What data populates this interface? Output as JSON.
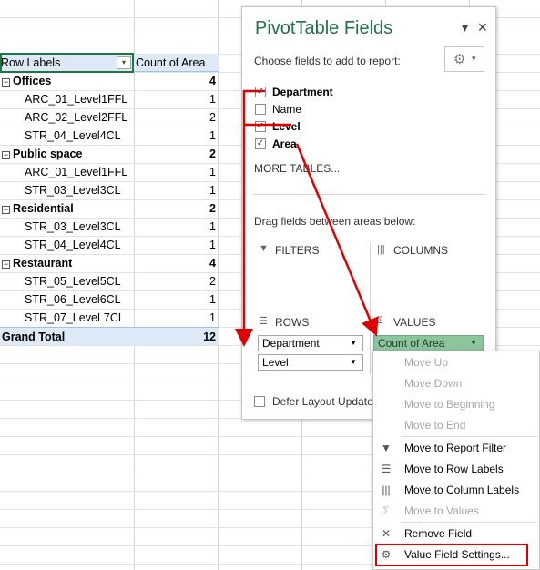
{
  "pivot": {
    "header": {
      "row_labels": "Row Labels",
      "count_col": "Count of Area",
      "filter_glyph": "▾"
    },
    "groups": [
      {
        "name": "Offices",
        "count": "4",
        "items": [
          {
            "name": "ARC_01_Level1FFL",
            "count": "1"
          },
          {
            "name": "ARC_02_Level2FFL",
            "count": "2"
          },
          {
            "name": "STR_04_Level4CL",
            "count": "1"
          }
        ]
      },
      {
        "name": "Public space",
        "count": "2",
        "items": [
          {
            "name": "ARC_01_Level1FFL",
            "count": "1"
          },
          {
            "name": "STR_03_Level3CL",
            "count": "1"
          }
        ]
      },
      {
        "name": "Residential",
        "count": "2",
        "items": [
          {
            "name": "STR_03_Level3CL",
            "count": "1"
          },
          {
            "name": "STR_04_Level4CL",
            "count": "1"
          }
        ]
      },
      {
        "name": "Restaurant",
        "count": "4",
        "items": [
          {
            "name": "STR_05_Level5CL",
            "count": "2"
          },
          {
            "name": "STR_06_Level6CL",
            "count": "1"
          },
          {
            "name": "STR_07_LeveL7CL",
            "count": "1"
          }
        ]
      }
    ],
    "grand_total": {
      "label": "Grand Total",
      "count": "12"
    },
    "expander_glyph": "−"
  },
  "pane": {
    "title": "PivotTable Fields",
    "dropdown_glyph": "▾",
    "close_glyph": "✕",
    "subtitle": "Choose fields to add to report:",
    "gear_glyph": "⚙",
    "gear_caret": "▾",
    "fields": [
      {
        "label": "Department",
        "checked": true,
        "bold": true
      },
      {
        "label": "Name",
        "checked": false,
        "bold": false
      },
      {
        "label": "Level",
        "checked": true,
        "bold": true
      },
      {
        "label": "Area",
        "checked": true,
        "bold": true
      }
    ],
    "check_glyph": "✓",
    "more_tables": "MORE TABLES...",
    "drag_hint": "Drag fields between areas below:",
    "areas": {
      "filters": "FILTERS",
      "columns": "COLUMNS",
      "rows": "ROWS",
      "values": "VALUES"
    },
    "rows_items": [
      "Department",
      "Level"
    ],
    "values_items": [
      "Count of Area"
    ],
    "defer_label": "Defer Layout Update"
  },
  "context_menu": {
    "items": [
      {
        "label": "Move Up",
        "enabled": false,
        "icon": ""
      },
      {
        "label": "Move Down",
        "enabled": false,
        "icon": ""
      },
      {
        "label": "Move to Beginning",
        "enabled": false,
        "icon": ""
      },
      {
        "label": "Move to End",
        "enabled": false,
        "icon": ""
      },
      {
        "label": "Move to Report Filter",
        "enabled": true,
        "icon": "filter-icon"
      },
      {
        "label": "Move to Row Labels",
        "enabled": true,
        "icon": "rows-icon"
      },
      {
        "label": "Move to Column Labels",
        "enabled": true,
        "icon": "columns-icon"
      },
      {
        "label": "Move to Values",
        "enabled": false,
        "icon": "sigma-icon"
      },
      {
        "label": "Remove Field",
        "enabled": true,
        "icon": "remove-icon"
      },
      {
        "label": "Value Field Settings...",
        "enabled": true,
        "icon": "settings-icon"
      }
    ]
  },
  "colors": {
    "accent_green": "#217346",
    "annotation_red": "#e00000",
    "header_blue": "#dde9f6",
    "values_chip": "#8cc49e"
  }
}
